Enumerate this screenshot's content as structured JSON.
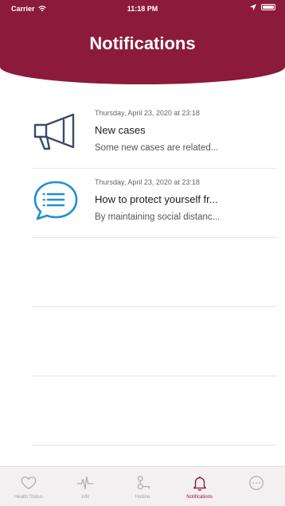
{
  "status_bar": {
    "carrier": "Carrier",
    "time": "11:18 PM"
  },
  "header": {
    "title": "Notifications",
    "background_color": "#8b1a3b"
  },
  "notifications": [
    {
      "icon": "megaphone-icon",
      "date": "Thursday, April 23, 2020 at 23:18",
      "title": "New cases",
      "body": "Some new cases are related..."
    },
    {
      "icon": "chat-bubble-icon",
      "date": "Thursday, April 23, 2020 at 23:18",
      "title": "How to protect yourself fr...",
      "body": "By maintaining social distanc..."
    }
  ],
  "tab_bar": {
    "active_color": "#8b1a3b",
    "tabs": [
      {
        "label": "Health Status",
        "icon": "heart-icon"
      },
      {
        "label": "Info",
        "icon": "pulse-icon"
      },
      {
        "label": "Hotline",
        "icon": "phone-icon"
      },
      {
        "label": "Notifications",
        "icon": "bell-icon"
      },
      {
        "label": "",
        "icon": "more-icon"
      }
    ],
    "active_index": 3
  }
}
